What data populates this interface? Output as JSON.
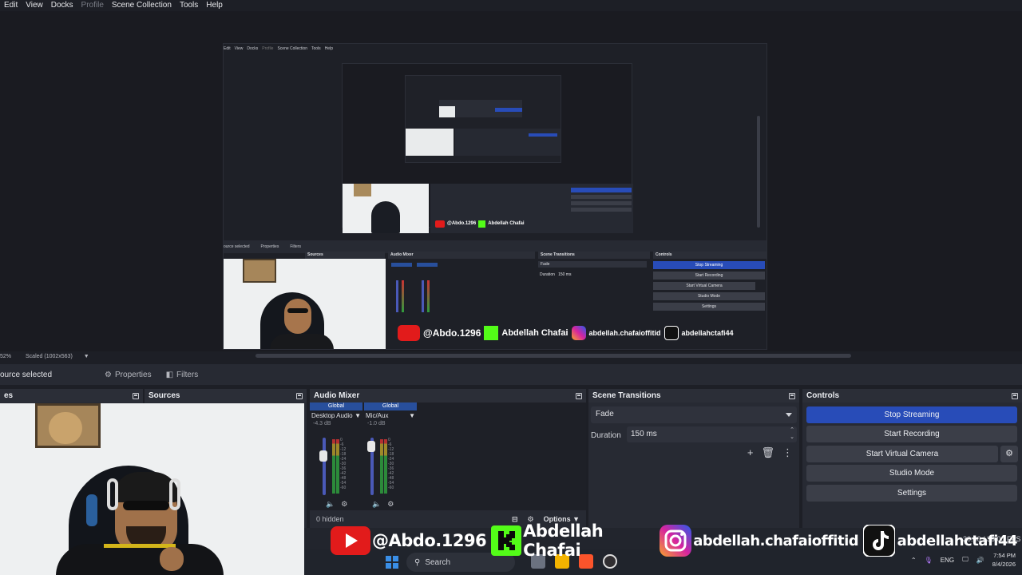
{
  "menu": [
    "Edit",
    "View",
    "Docks",
    "Profile",
    "Scene Collection",
    "Tools",
    "Help"
  ],
  "status_strip": {
    "zoom": "52%",
    "scale_mode": "Scaled (1002x563)"
  },
  "source_toolbar": {
    "status": "ource selected",
    "properties": "Properties",
    "filters": "Filters"
  },
  "docks": {
    "scenes_title": "es",
    "sources_title": "Sources",
    "mixer_title": "Audio Mixer",
    "transitions_title": "Scene Transitions",
    "controls_title": "Controls"
  },
  "mixer": {
    "channels": [
      {
        "header": "Global",
        "name": "Desktop Audio",
        "db": "-4.3 dB",
        "level": 0.78
      },
      {
        "header": "Global",
        "name": "Mic/Aux",
        "db": "-1.0 dB",
        "level": 0.95
      }
    ],
    "meter_scale": [
      "0",
      "-6",
      "-12",
      "-18",
      "-24",
      "-30",
      "-36",
      "-42",
      "-48",
      "-54",
      "-60"
    ],
    "hidden_count": "0 hidden",
    "options_label": "Options"
  },
  "transitions": {
    "type": "Fade",
    "duration_label": "Duration",
    "duration_value": "150 ms"
  },
  "controls": {
    "buttons": [
      "Stop Streaming",
      "Start Recording",
      "Start Virtual Camera",
      "Studio Mode",
      "Settings"
    ]
  },
  "banner": {
    "youtube": "@Abdo.1296",
    "kick": "Abdellah Chafai",
    "instagram": "abdellah.chafaioffitid",
    "tiktok": "abdellahctafi44"
  },
  "fps": "30.00 / 30.00 FPS",
  "taskbar": {
    "search_label": "Search",
    "language": "ENG",
    "time": "7:54 PM",
    "date": "8/4/2026"
  },
  "nested": {
    "menu": [
      "Edit",
      "View",
      "Docks",
      "Profile",
      "Scene Collection",
      "Tools",
      "Help"
    ],
    "status": "ource selected",
    "properties": "Properties",
    "filters": "Filters",
    "sources": "Sources",
    "mixer": "Audio Mixer",
    "transitions": "Scene Transitions",
    "controls": "Controls",
    "fade": "Fade",
    "duration": "Duration",
    "duration_value": "150 ms",
    "buttons": [
      "Stop Streaming",
      "Start Recording",
      "Start Virtual Camera",
      "Studio Mode",
      "Settings"
    ],
    "banner_youtube": "@Abdo.1296",
    "banner_kick": "Abdellah Chafai",
    "banner_instagram": "abdellah.chafaioffitid",
    "banner_tiktok": "abdellahctafi44"
  },
  "colors": {
    "accent": "#284cb8",
    "bg": "#1d1f26",
    "dock": "#272a33"
  }
}
